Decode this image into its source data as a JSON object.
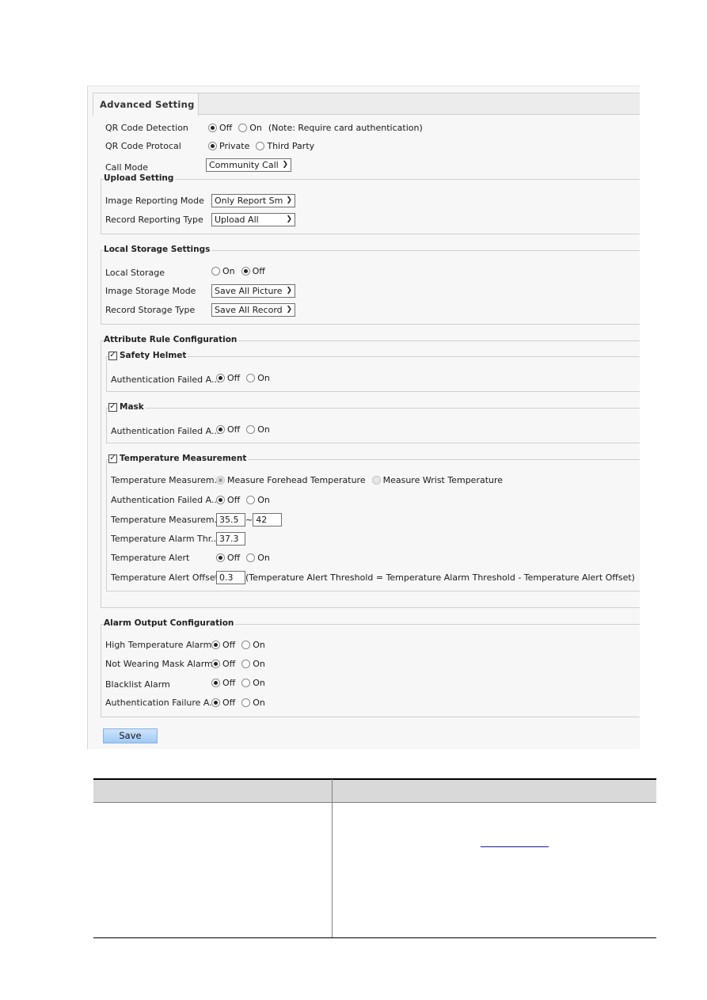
{
  "tab": {
    "label": "Advanced Setting"
  },
  "general": {
    "qr_detection": {
      "label": "QR Code Detection",
      "options": [
        "Off",
        "On"
      ],
      "selected": "Off",
      "note": "(Note: Require card authentication)"
    },
    "qr_protocol": {
      "label": "QR Code Protocal",
      "options": [
        "Private",
        "Third Party"
      ],
      "selected": "Private"
    },
    "call_mode": {
      "label": "Call Mode",
      "value": "Community Call"
    }
  },
  "upload_setting": {
    "title": "Upload Setting",
    "image_reporting_mode": {
      "label": "Image Reporting Mode",
      "value": "Only Report Sm"
    },
    "record_reporting_type": {
      "label": "Record Reporting Type",
      "value": "Upload All"
    }
  },
  "local_storage": {
    "title": "Local Storage Settings",
    "local_storage": {
      "label": "Local Storage",
      "options": [
        "On",
        "Off"
      ],
      "selected": "Off"
    },
    "image_storage_mode": {
      "label": "Image Storage Mode",
      "value": "Save All Picture"
    },
    "record_storage_type": {
      "label": "Record Storage Type",
      "value": "Save All Record"
    }
  },
  "attribute_rules": {
    "title": "Attribute Rule Configuration",
    "safety_helmet": {
      "title": "Safety Helmet",
      "checked": true,
      "auth_failed": {
        "label": "Authentication Failed A...",
        "options": [
          "Off",
          "On"
        ],
        "selected": "Off"
      }
    },
    "mask": {
      "title": "Mask",
      "checked": true,
      "auth_failed": {
        "label": "Authentication Failed A...",
        "options": [
          "Off",
          "On"
        ],
        "selected": "Off"
      }
    },
    "temperature": {
      "title": "Temperature Measurement",
      "checked": true,
      "mode": {
        "label": "Temperature Measurem...",
        "options": [
          "Measure Forehead Temperature",
          "Measure Wrist Temperature"
        ],
        "selected": "Measure Forehead Temperature"
      },
      "auth_failed": {
        "label": "Authentication Failed A...",
        "options": [
          "Off",
          "On"
        ],
        "selected": "Off"
      },
      "range": {
        "label": "Temperature Measurem...",
        "min": "35.5",
        "separator": "~",
        "max": "42"
      },
      "alarm_threshold": {
        "label": "Temperature Alarm Thr...",
        "value": "37.3"
      },
      "alert": {
        "label": "Temperature Alert",
        "options": [
          "Off",
          "On"
        ],
        "selected": "Off"
      },
      "alert_offset": {
        "label": "Temperature Alert Offset",
        "value": "0.3",
        "note": "(Temperature Alert Threshold = Temperature Alarm Threshold - Temperature Alert Offset)"
      }
    }
  },
  "alarm_output": {
    "title": "Alarm Output Configuration",
    "items": [
      {
        "label": "High Temperature Alarm",
        "options": [
          "Off",
          "On"
        ],
        "selected": "Off"
      },
      {
        "label": "Not Wearing Mask Alarm",
        "options": [
          "Off",
          "On"
        ],
        "selected": "Off"
      },
      {
        "label": "Blacklist Alarm",
        "options": [
          "Off",
          "On"
        ],
        "selected": "Off"
      },
      {
        "label": "Authentication Failure A...",
        "options": [
          "Off",
          "On"
        ],
        "selected": "Off"
      }
    ]
  },
  "save_label": "Save",
  "colors": {
    "save_button": "#9ecaf5",
    "panel_bg": "#f7f7f7",
    "table_header_bg": "#d9d9d9"
  }
}
